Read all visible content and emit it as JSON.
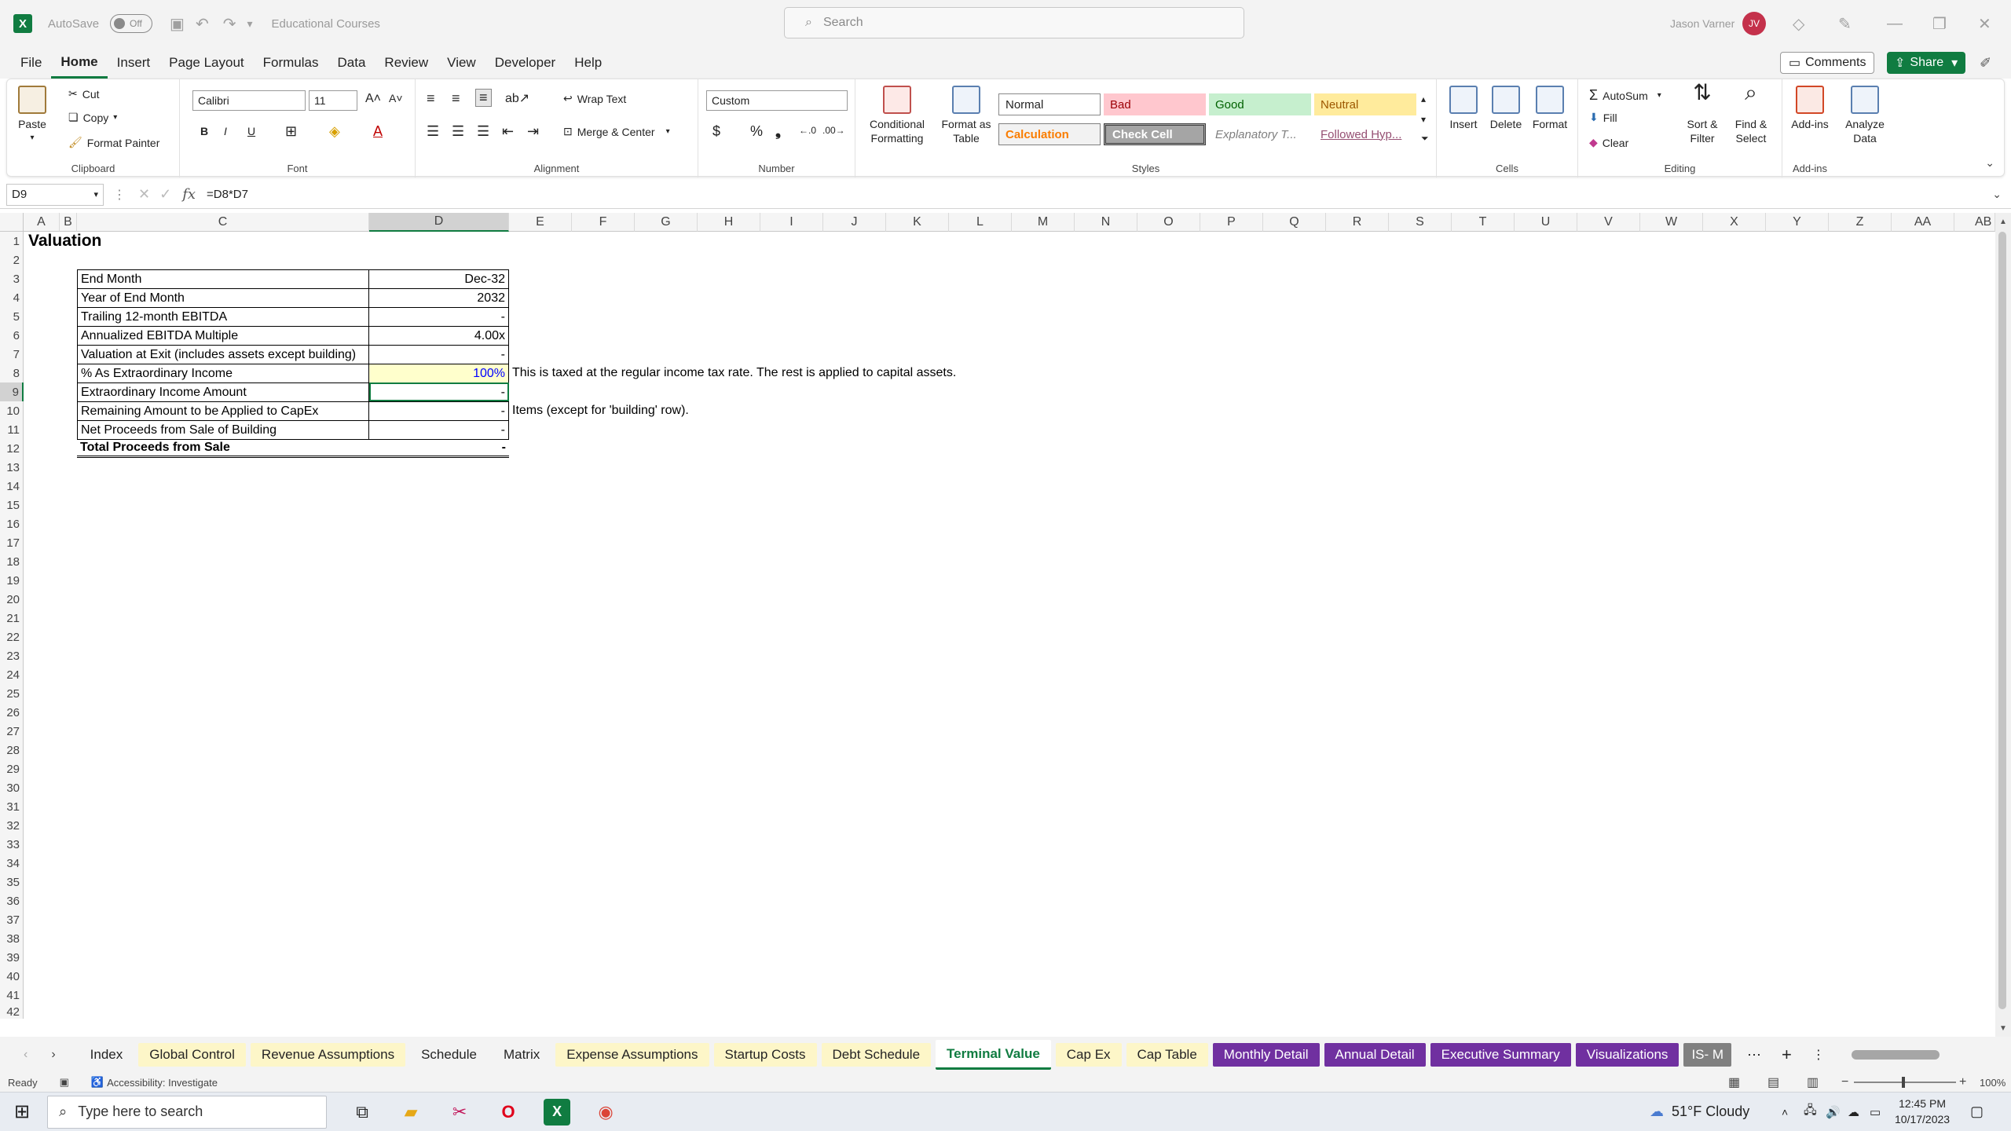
{
  "titlebar": {
    "app_letter": "X",
    "autosave_label": "AutoSave",
    "autosave_state": "Off",
    "doc_title": "Educational Courses",
    "search_placeholder": "Search",
    "user_name": "Jason Varner",
    "user_initials": "JV"
  },
  "menu": [
    "File",
    "Home",
    "Insert",
    "Page Layout",
    "Formulas",
    "Data",
    "Review",
    "View",
    "Developer",
    "Help"
  ],
  "menu_active": "Home",
  "comments_label": "Comments",
  "share_label": "Share",
  "ribbon": {
    "clipboard": {
      "paste": "Paste",
      "cut": "Cut",
      "copy": "Copy",
      "format_painter": "Format Painter",
      "label": "Clipboard"
    },
    "font": {
      "name": "Calibri",
      "size": "11",
      "label": "Font"
    },
    "alignment": {
      "wrap": "Wrap Text",
      "merge": "Merge & Center",
      "label": "Alignment"
    },
    "number": {
      "format": "Custom",
      "label": "Number"
    },
    "styles": {
      "cond_format": "Conditional Formatting",
      "format_table": "Format as Table",
      "normal": "Normal",
      "bad": "Bad",
      "good": "Good",
      "neutral": "Neutral",
      "calculation": "Calculation",
      "check_cell": "Check Cell",
      "explanatory": "Explanatory T...",
      "followed": "Followed Hyp...",
      "label": "Styles"
    },
    "cells": {
      "insert": "Insert",
      "delete": "Delete",
      "format": "Format",
      "label": "Cells"
    },
    "editing": {
      "autosum": "AutoSum",
      "fill": "Fill",
      "clear": "Clear",
      "sort": "Sort & Filter",
      "find": "Find & Select",
      "label": "Editing"
    },
    "addins": {
      "addins": "Add-ins",
      "analyze": "Analyze Data",
      "label": "Add-ins"
    }
  },
  "formula_bar": {
    "name_box": "D9",
    "formula": "=D8*D7"
  },
  "columns": [
    "A",
    "B",
    "C",
    "D",
    "E",
    "F",
    "G",
    "H",
    "I",
    "J",
    "K",
    "L",
    "M",
    "N",
    "O",
    "P",
    "Q",
    "R",
    "S",
    "T",
    "U",
    "V",
    "W",
    "X",
    "Y",
    "Z",
    "AA",
    "AB"
  ],
  "rows": [
    "1",
    "2",
    "3",
    "4",
    "5",
    "6",
    "7",
    "8",
    "9",
    "10",
    "11",
    "12",
    "13",
    "14",
    "15",
    "16",
    "17",
    "18",
    "19",
    "20",
    "21",
    "22",
    "23",
    "24",
    "25",
    "26",
    "27",
    "28",
    "29",
    "30",
    "31",
    "32",
    "33",
    "34",
    "35",
    "36",
    "37",
    "38",
    "39",
    "40",
    "41",
    "42"
  ],
  "sheet": {
    "title": "Valuation",
    "table": [
      {
        "label": "End Month",
        "value": "Dec-32"
      },
      {
        "label": "Year of End Month",
        "value": "2032"
      },
      {
        "label": "Trailing 12-month EBITDA",
        "value": "-"
      },
      {
        "label": "Annualized EBITDA Multiple",
        "value": "4.00x"
      },
      {
        "label": "Valuation at Exit (includes assets except building)",
        "value": "-"
      },
      {
        "label": "% As Extraordinary Income",
        "value": "100%",
        "note": "This is taxed at the regular income tax rate. The rest is applied to capital assets."
      },
      {
        "label": "Extraordinary Income Amount",
        "value": "-"
      },
      {
        "label": "Remaining Amount to be Applied to CapEx",
        "value": "-",
        "note": "Items (except for 'building' row)."
      },
      {
        "label": "Net Proceeds from Sale of Building",
        "value": "-"
      },
      {
        "label": "Total Proceeds from Sale",
        "value": "-"
      }
    ]
  },
  "tabs": [
    {
      "label": "Index",
      "color": "#f3f3f3"
    },
    {
      "label": "Global Control",
      "color": "#fdf6c8"
    },
    {
      "label": "Revenue Assumptions",
      "color": "#fdf6c8"
    },
    {
      "label": "Schedule",
      "color": "#f3f3f3"
    },
    {
      "label": "Matrix",
      "color": "#f3f3f3"
    },
    {
      "label": "Expense Assumptions",
      "color": "#fdf6c8"
    },
    {
      "label": "Startup Costs",
      "color": "#fdf6c8"
    },
    {
      "label": "Debt Schedule",
      "color": "#fdf6c8"
    },
    {
      "label": "Terminal Value",
      "color": "#ffffff"
    },
    {
      "label": "Cap Ex",
      "color": "#fdf6c8"
    },
    {
      "label": "Cap Table",
      "color": "#fdf6c8"
    },
    {
      "label": "Monthly Detail",
      "color": "#7030a0"
    },
    {
      "label": "Annual Detail",
      "color": "#7030a0"
    },
    {
      "label": "Executive Summary",
      "color": "#7030a0"
    },
    {
      "label": "Visualizations",
      "color": "#7030a0"
    },
    {
      "label": "IS- M",
      "color": "#808080"
    }
  ],
  "active_tab": "Terminal Value",
  "status": {
    "ready": "Ready",
    "accessibility": "Accessibility: Investigate",
    "zoom": "100%"
  },
  "taskbar": {
    "search_placeholder": "Type here to search",
    "weather": "51°F  Cloudy",
    "time": "12:45 PM",
    "date": "10/17/2023"
  }
}
